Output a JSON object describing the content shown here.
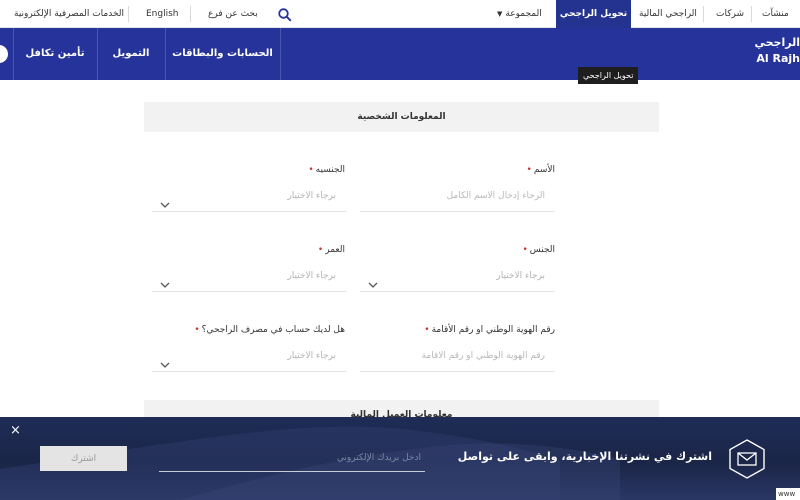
{
  "topbar": {
    "establishments": "منشآت",
    "companies": "شركات",
    "financial": "الراجحي المالية",
    "transfer": "تحويل الراجحي",
    "group": "المجموعة",
    "search_branch": "بحث عن فرع",
    "english": "English",
    "e_services": "الخدمات المصرفية الإلكترونية"
  },
  "logo": {
    "ar": "الراجحي",
    "en": "Al Rajh"
  },
  "nav": {
    "takaful": "تأمين تكافل",
    "financing": "التمويل",
    "accounts": "الحسابات والبطاقات"
  },
  "tooltip": "تحويل الراجحي",
  "form": {
    "section_personal": "المعلومات الشخصية",
    "section_financial": "معلومات العميل المالية",
    "name_label": "الأسم",
    "name_placeholder": "الرجاء إدخال الاسم الكامل",
    "nationality_label": "الجنسيه",
    "select_placeholder": "برجاء الاختيار",
    "gender_label": "الجنس",
    "age_label": "العمر",
    "id_label": "رقم الهوية الوطني او رقم الأقامة",
    "id_placeholder": "رقم الهوية الوطني او رقم الأقامة",
    "account_label": "هل لديك حساب في مصرف الراجحي؟"
  },
  "newsletter": {
    "text": "اشترك في نشرتنا الإخبارية، وابقى على تواصل",
    "email_placeholder": "أدخل بريدك الإلكتروني",
    "subscribe": "اشترك",
    "close": "×"
  },
  "corner": "www",
  "colors": {
    "brand": "#25339a",
    "required": "#c0392b",
    "newsletter_bg": "#1f2c56"
  }
}
